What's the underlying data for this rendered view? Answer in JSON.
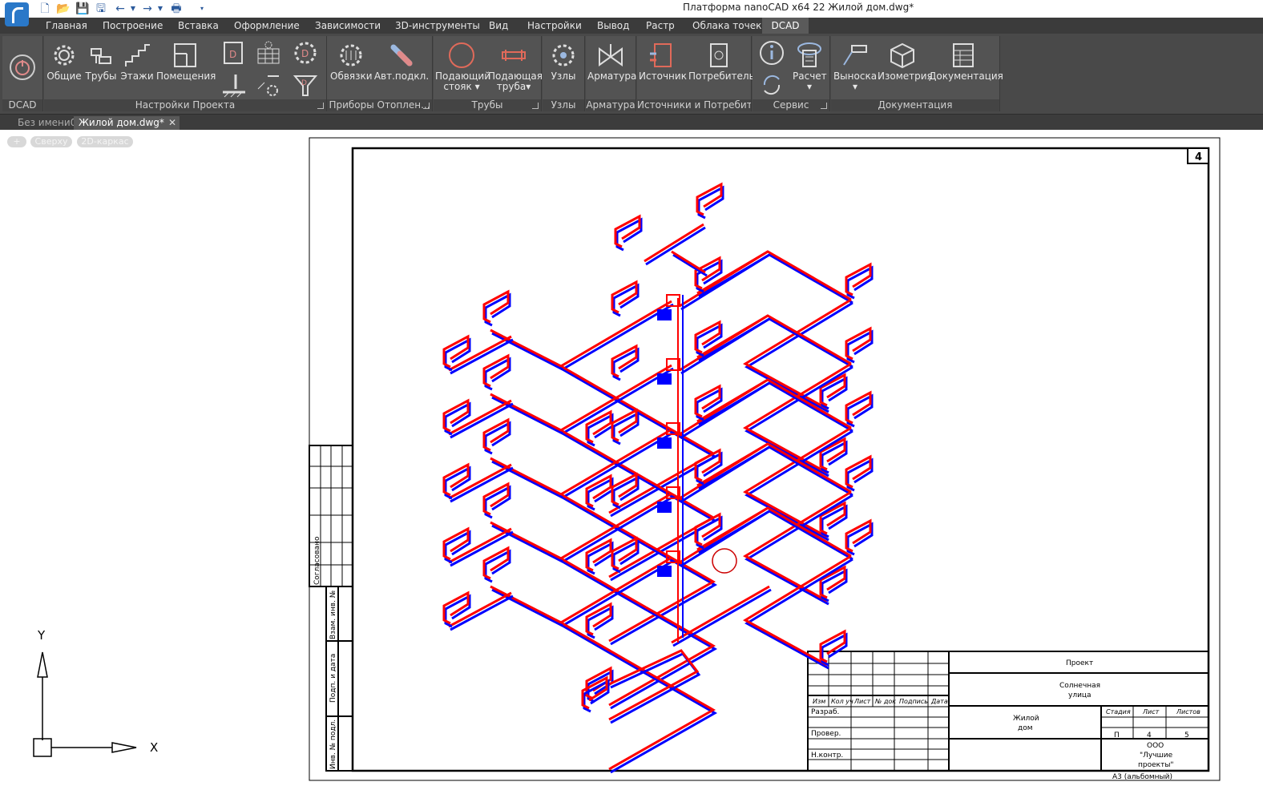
{
  "window": {
    "title": "Платформа nanoCAD x64 22 Жилой дом.dwg*"
  },
  "quick_access": {
    "icons": [
      "new-file-icon",
      "open-icon",
      "save-icon",
      "save-all-icon",
      "undo-icon",
      "redo-icon",
      "print-icon"
    ]
  },
  "menu": {
    "tabs": [
      "Главная",
      "Построение",
      "Вставка",
      "Оформление",
      "Зависимости",
      "3D-инструменты",
      "Вид",
      "Настройки",
      "Вывод",
      "Растр",
      "Облака точек"
    ],
    "active_tab": "DCAD"
  },
  "ribbon": {
    "panels": {
      "dcad": "DCAD",
      "project": "Настройки Проекта",
      "devices": "Приборы Отоплен...",
      "pipes": "Трубы",
      "nodes": "Узлы",
      "fittings": "Арматура",
      "sources": "Источники и Потребите...",
      "service": "Сервис",
      "docs": "Документация"
    },
    "buttons": {
      "general": "Общие",
      "pipes": "Трубы",
      "floors": "Этажи",
      "rooms": "Помещения",
      "bindings": "Обвязки",
      "auto_connect": "Авт.подкл.",
      "supply_riser_1": "Подающий",
      "supply_riser_2": "стояк",
      "supply_pipe_1": "Подающая",
      "supply_pipe_2": "труба",
      "nodes": "Узлы",
      "fittings": "Арматура",
      "source": "Источник",
      "consumer": "Потребитель",
      "calc": "Расчет",
      "leader": "Выноска",
      "isometry": "Изометрия",
      "documentation": "Документация"
    }
  },
  "doc_tabs": {
    "inactive": "Без имени0",
    "active": "Жилой дом.dwg*",
    "close": "✕"
  },
  "view_controls": {
    "plus": "+",
    "view": "Сверху",
    "style": "2D-каркас"
  },
  "ucs": {
    "x": "X",
    "y": "Y"
  },
  "sheet": {
    "sheet_number": "4",
    "side_stamp": {
      "agreed": "Согласовано",
      "inv_swap": "Взам. инв. №",
      "sign_date": "Подп. и дата",
      "inv_orig": "Инв. № подл."
    },
    "title_block": {
      "headers": [
        "Изм",
        "Кол уч",
        "Лист",
        "№ док",
        "Подпись",
        "Дата"
      ],
      "developed": "Разраб.",
      "checked": "Провер.",
      "norm": "Н.контр.",
      "project": "Проект",
      "street_1": "Солнечная",
      "street_2": "улица",
      "building_1": "Жилой",
      "building_2": "дом",
      "stage_label": "Стадия",
      "sheet_label": "Лист",
      "sheets_label": "Листов",
      "stage": "П",
      "sheet": "4",
      "sheets": "5",
      "org_1": "ООО",
      "org_2": "\"Лучшие",
      "org_3": "проекты\"",
      "format": "А3 (альбомный)"
    }
  },
  "colors": {
    "supply": "#ff0000",
    "return": "#0000ff",
    "ribbon_bg": "#494949",
    "menubar": "#3b3b3b"
  }
}
